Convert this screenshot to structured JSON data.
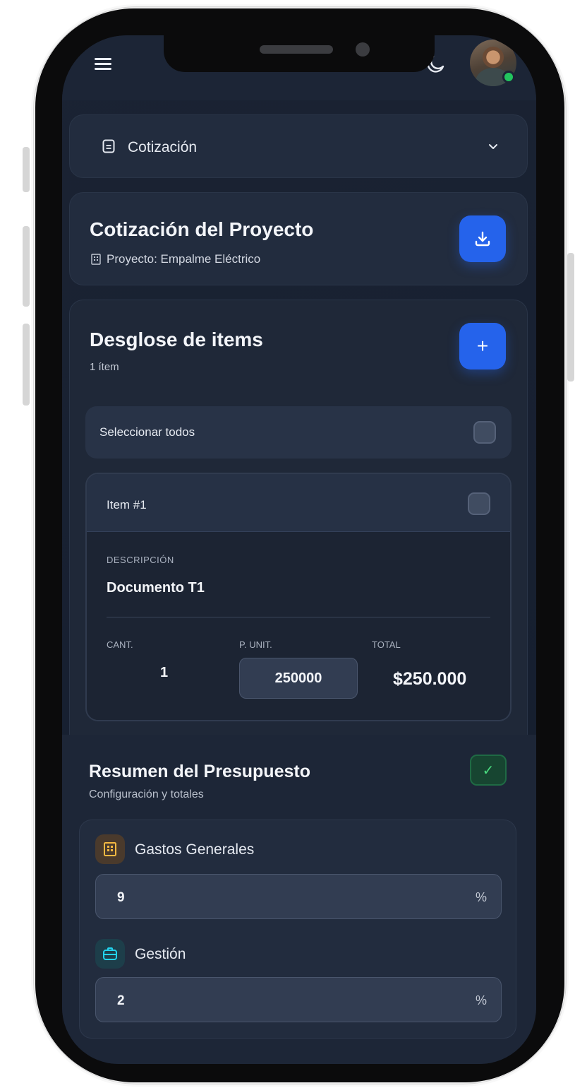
{
  "colors": {
    "background": "#172031",
    "card": "#222c3e",
    "accent_blue": "#2563eb",
    "success_green": "#22c55e",
    "text_primary": "#f3f5f9"
  },
  "header": {
    "menu_icon": "hamburger-menu-icon",
    "theme_icon": "moon-icon",
    "avatar_icon": "user-avatar"
  },
  "section_select": {
    "label": "Cotización",
    "icon": "document-icon",
    "chevron": "chevron-down-icon"
  },
  "project": {
    "title": "Cotización del Proyecto",
    "subtitle": "Proyecto: Empalme Eléctrico",
    "download_icon": "download-icon"
  },
  "breakdown": {
    "title": "Desglose de items",
    "count": "1 ítem",
    "add_label": "+",
    "select_all_label": "Seleccionar todos"
  },
  "items": [
    {
      "name": "Item #1",
      "description_label": "DESCRIPCIÓN",
      "description": "Documento T1",
      "qty_label": "CANT.",
      "qty": "1",
      "unit_price_label": "P. UNIT.",
      "unit_price": "250000",
      "total_label": "TOTAL",
      "total": "$250.000"
    }
  ],
  "summary": {
    "title": "Resumen del Presupuesto",
    "subtitle": "Configuración y totales",
    "check_mark": "✓",
    "gastos_label": "Gastos Generales",
    "gastos_value": "9",
    "gastos_unit": "%",
    "gestion_label": "Gestión",
    "gestion_value": "2",
    "gestion_unit": "%"
  }
}
